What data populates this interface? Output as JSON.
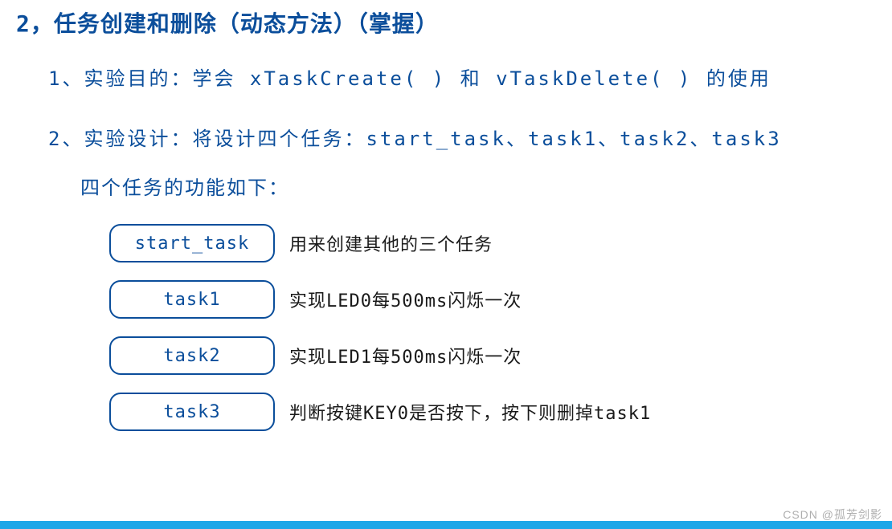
{
  "heading": "2，任务创建和删除（动态方法）（掌握）",
  "line1": "1、实验目的：学会 xTaskCreate( )  和 vTaskDelete( ) 的使用",
  "line2": "2、实验设计：将设计四个任务：start_task、task1、task2、task3",
  "subline": "四个任务的功能如下：",
  "tasks": [
    {
      "name": "start_task",
      "desc": "用来创建其他的三个任务"
    },
    {
      "name": "task1",
      "desc": "实现LED0每500ms闪烁一次"
    },
    {
      "name": "task2",
      "desc": "实现LED1每500ms闪烁一次"
    },
    {
      "name": "task3",
      "desc": "判断按键KEY0是否按下，按下则删掉task1"
    }
  ],
  "watermark": "CSDN @孤芳剑影"
}
